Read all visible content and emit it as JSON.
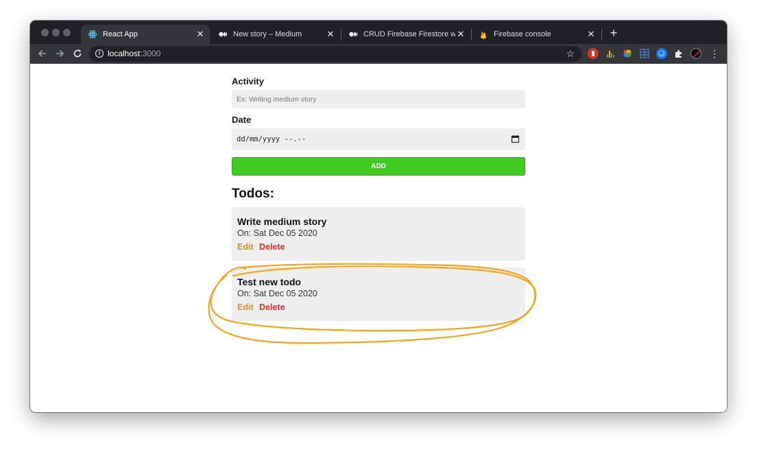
{
  "browser": {
    "tabs": [
      {
        "title": "React App",
        "icon": "react-logo-icon",
        "close": "✕"
      },
      {
        "title": "New story – Medium",
        "icon": "medium-logo-icon",
        "close": "✕"
      },
      {
        "title": "CRUD Firebase Firestore with R",
        "icon": "medium-logo-icon",
        "close": "✕"
      },
      {
        "title": "Firebase console",
        "icon": "firebase-flame-icon",
        "close": "✕"
      }
    ],
    "new_tab": "+",
    "url_host": "localhost",
    "url_port": ":3000"
  },
  "form": {
    "activity_label": "Activity",
    "activity_placeholder": "Ex: Writing medium story",
    "date_label": "Date",
    "date_placeholder": "dd/mm/yyyy --.--",
    "add_button": "ADD"
  },
  "todos": {
    "heading": "Todos:",
    "items": [
      {
        "title": "Write medium story",
        "date": "On: Sat Dec 05 2020",
        "edit": "Edit",
        "delete": "Delete"
      },
      {
        "title": "Test new todo",
        "date": "On: Sat Dec 05 2020",
        "edit": "Edit",
        "delete": "Delete"
      }
    ]
  },
  "colors": {
    "add_button": "#42cb21",
    "edit": "#e0901f",
    "delete": "#d93027",
    "highlight": "#f5a516"
  }
}
